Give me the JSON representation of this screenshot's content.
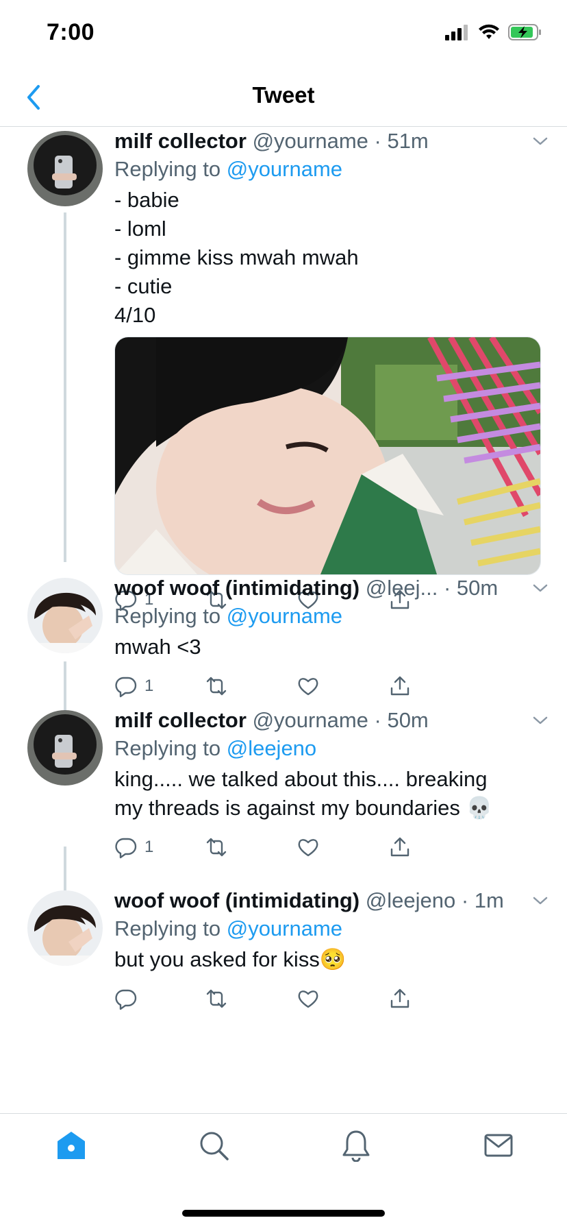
{
  "status_bar": {
    "time": "7:00"
  },
  "nav": {
    "title": "Tweet"
  },
  "tweets": [
    {
      "name": "milf collector",
      "handle": "@yourname",
      "time": "51m",
      "replying_prefix": "Replying to",
      "replying_to": "@yourname",
      "lines": [
        "- babie",
        "- loml",
        "- gimme kiss mwah mwah",
        "- cutie",
        "4/10"
      ],
      "reply_count": "1"
    },
    {
      "name": "woof woof (intimidating)",
      "handle": "@leej...",
      "time": "50m",
      "replying_prefix": "Replying to",
      "replying_to": "@yourname",
      "lines": [
        "mwah <3"
      ],
      "reply_count": "1"
    },
    {
      "name": "milf collector",
      "handle": "@yourname",
      "time": "50m",
      "replying_prefix": "Replying to",
      "replying_to": "@leejeno",
      "lines": [
        "king..... we talked about this.... breaking",
        "my threads is against my boundaries 💀"
      ],
      "reply_count": "1"
    },
    {
      "name": "woof woof (intimidating)",
      "handle": "@leejeno",
      "time": "1m",
      "replying_prefix": "Replying to",
      "replying_to": "@yourname",
      "lines": [
        "but you asked for kiss🥺"
      ],
      "reply_count": ""
    }
  ],
  "colors": {
    "accent": "#1d9bf0",
    "secondary_text": "#536471",
    "divider": "#cfd9de"
  },
  "tabs": [
    "home-icon",
    "search-icon",
    "notifications-icon",
    "messages-icon"
  ]
}
